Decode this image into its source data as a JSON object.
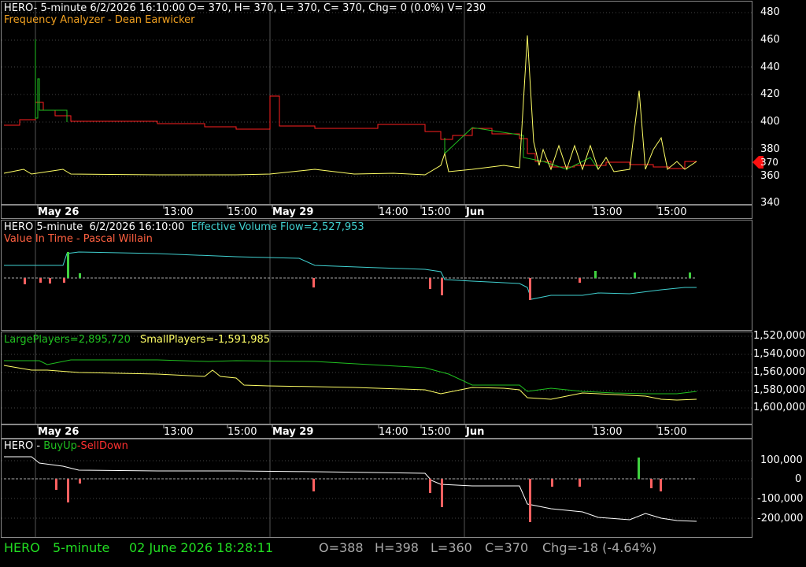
{
  "colors": {
    "background": "#000000",
    "frame": "#888888",
    "white": "#ffffff",
    "orange": "#f0a020",
    "yellow": "#ffff66",
    "red": "#ff2020",
    "green": "#20c020",
    "cyan": "#40d0d0",
    "status_green": "#22dd22",
    "status_gray": "#aaaaaa",
    "price_tag": "#ff1010"
  },
  "panel1": {
    "header": "HERO- 5-minute 6/2/2026 16:10:00 O= 370, H= 370, L= 370, C= 370, Chg= 0 (0.0%) V= 230",
    "subtitle": "Frequency Analyzer - Dean Earwicker",
    "price_tag": "370",
    "y_ticks": [
      "340",
      "360",
      "380",
      "400",
      "420",
      "440",
      "460",
      "480"
    ]
  },
  "axis_labels": [
    "May 26",
    "13:00",
    "15:00",
    "May 29",
    "14:00",
    "15:00",
    "Jun",
    "13:00",
    "15:00"
  ],
  "panel2": {
    "header_prefix": "HERO 5-minute  6/2/2026 16:10:00",
    "header_value": "Effective Volume Flow=2,527,953",
    "subtitle": "Value In Time - Pascal Willain"
  },
  "panel3": {
    "large_players": "LargePlayers=2,895,720",
    "small_players": "SmallPlayers=-1,591,985",
    "y_ticks": [
      "1,520,000",
      "1,540,000",
      "1,560,000",
      "1,580,000",
      "1,600,000"
    ]
  },
  "panel4": {
    "title_prefix": "HERO - ",
    "buy_up": "BuyUp",
    "dash": "-",
    "sell_down": "SellDown",
    "y_ticks": [
      "100,000",
      "0",
      "-100,000",
      "-200,000"
    ]
  },
  "status_bar": {
    "symbol": "HERO",
    "interval": "5-minute",
    "datetime": "02 June 2026 18:28:11",
    "open": "O=388",
    "high": "H=398",
    "low": "L=360",
    "close": "C=370",
    "change": "Chg=-18 (-4.64%)"
  }
}
